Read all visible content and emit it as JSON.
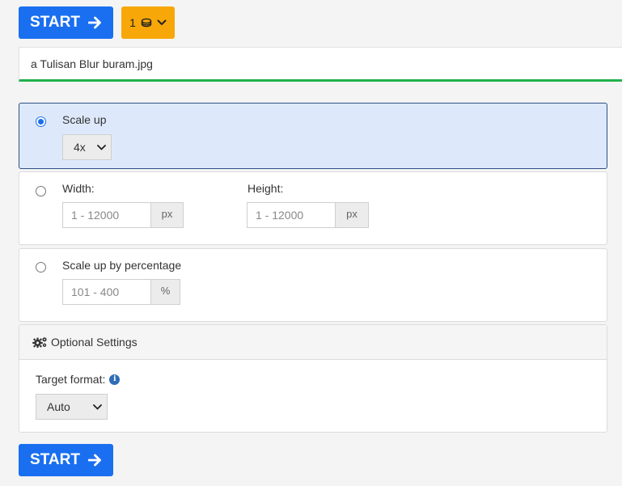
{
  "toolbar": {
    "start_label": "START",
    "credits_value": "1",
    "credits_icon": "coins-icon"
  },
  "file": {
    "name": "a Tulisan Blur buram.jpg"
  },
  "options": {
    "scale_up": {
      "label": "Scale up",
      "selected": true,
      "factor_value": "4x"
    },
    "dimensions": {
      "width_label": "Width:",
      "height_label": "Height:",
      "width_placeholder": "1 - 12000",
      "height_placeholder": "1 - 12000",
      "unit": "px"
    },
    "percentage": {
      "label": "Scale up by percentage",
      "placeholder": "101 - 400",
      "unit": "%"
    }
  },
  "optional_settings": {
    "title": "Optional Settings",
    "target_format_label": "Target format:",
    "target_format_value": "Auto"
  },
  "colors": {
    "primary": "#1a6ff0",
    "credits": "#f7a707",
    "success_underline": "#22b14c",
    "selected_bg": "#dde9fb"
  }
}
